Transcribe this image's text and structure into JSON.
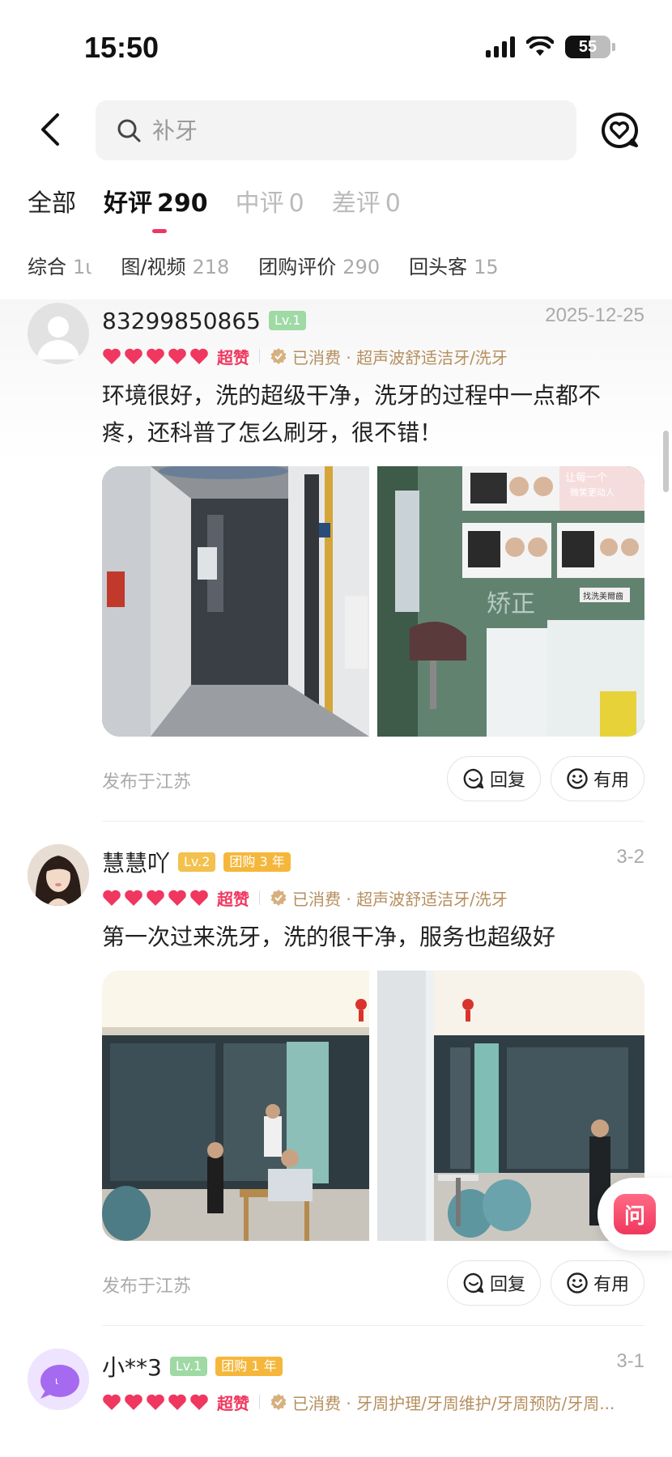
{
  "status_bar": {
    "time": "15:50",
    "battery": "55",
    "battery_level": 0.55
  },
  "header": {
    "search_placeholder": "补牙"
  },
  "tabs": [
    {
      "label": "全部",
      "count": ""
    },
    {
      "label": "好评",
      "count": "290"
    },
    {
      "label": "中评",
      "count": "0"
    },
    {
      "label": "差评",
      "count": "0"
    }
  ],
  "filters": [
    {
      "label": "综合",
      "count": "1ι"
    },
    {
      "label": "图/视频",
      "count": "218"
    },
    {
      "label": "团购评价",
      "count": "290"
    },
    {
      "label": "回头客",
      "count": "15"
    }
  ],
  "reviews": [
    {
      "username": "83299850865",
      "level": "Lv.1",
      "group_badge": "",
      "date": "2025-12-25",
      "rating_label": "超赞",
      "consumed": "已消费 · 超声波舒适洁牙/洗牙",
      "content": "环境很好，洗的超级干净，洗牙的过程中一点都不疼，还科普了怎么刷牙，很不错！",
      "location": "发布于江苏",
      "reply_label": "回复",
      "useful_label": "有用",
      "photo_text": {
        "sign_top": "让每一个",
        "sign_sub": "微笑更动人",
        "window_text": "矫正",
        "window_small": "找洗美爾齒"
      }
    },
    {
      "username": "慧慧吖",
      "level": "Lv.2",
      "group_badge": "团购 3 年",
      "date": "3-2",
      "rating_label": "超赞",
      "consumed": "已消费 · 超声波舒适洁牙/洗牙",
      "content": "第一次过来洗牙，洗的很干净，服务也超级好",
      "location": "发布于江苏",
      "reply_label": "回复",
      "useful_label": "有用"
    },
    {
      "username": "小**3",
      "level": "Lv.1",
      "group_badge": "团购 1 年",
      "date": "3-1",
      "rating_label": "超赞",
      "consumed": "已消费 · 牙周护理/牙周维护/牙周预防/牙周..."
    }
  ],
  "floating": {
    "ask_label": "问"
  },
  "colors": {
    "accent": "#f0375f",
    "gold": "#b58f5f",
    "lv1": "#9fd9a4",
    "lv2": "#f3c14d"
  }
}
